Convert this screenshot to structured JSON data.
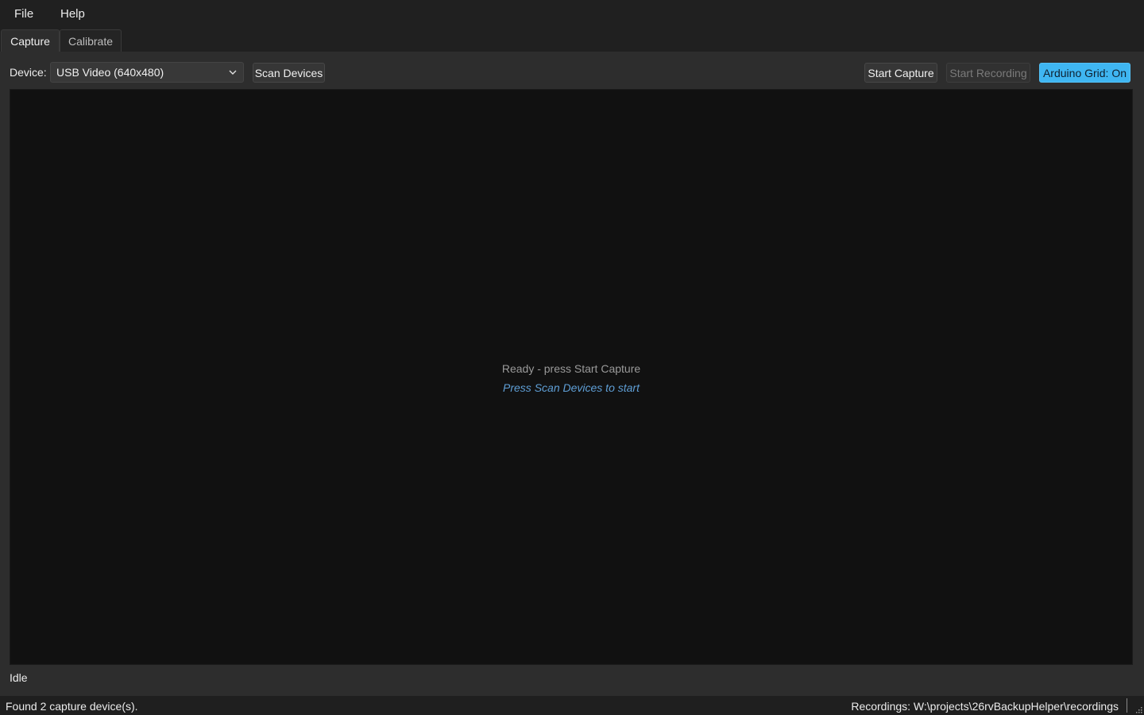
{
  "menu": {
    "file_label": "File",
    "help_label": "Help"
  },
  "tabs": {
    "capture_label": "Capture",
    "calibrate_label": "Calibrate",
    "active": "Capture"
  },
  "toolbar": {
    "device_label": "Device:",
    "device_value": "USB Video (640x480)",
    "scan_label": "Scan Devices",
    "start_capture_label": "Start Capture",
    "start_recording_label": "Start Recording",
    "arduino_label": "Arduino Grid: On"
  },
  "preview": {
    "ready_text": "Ready - press Start Capture",
    "hint_text": "Press Scan Devices to start"
  },
  "state_text": "Idle",
  "statusbar": {
    "left_text": "Found 2 capture device(s).",
    "right_text": "Recordings: W:\\projects\\26rvBackupHelper\\recordings"
  },
  "colors": {
    "accent": "#3fb6f2",
    "hint": "#5f9fd6",
    "background": "#1f1f1f",
    "panel": "#2d2d2d",
    "preview": "#111111"
  },
  "icons": {
    "dropdown": "chevron-down-icon",
    "grip": "resize-grip-icon"
  }
}
